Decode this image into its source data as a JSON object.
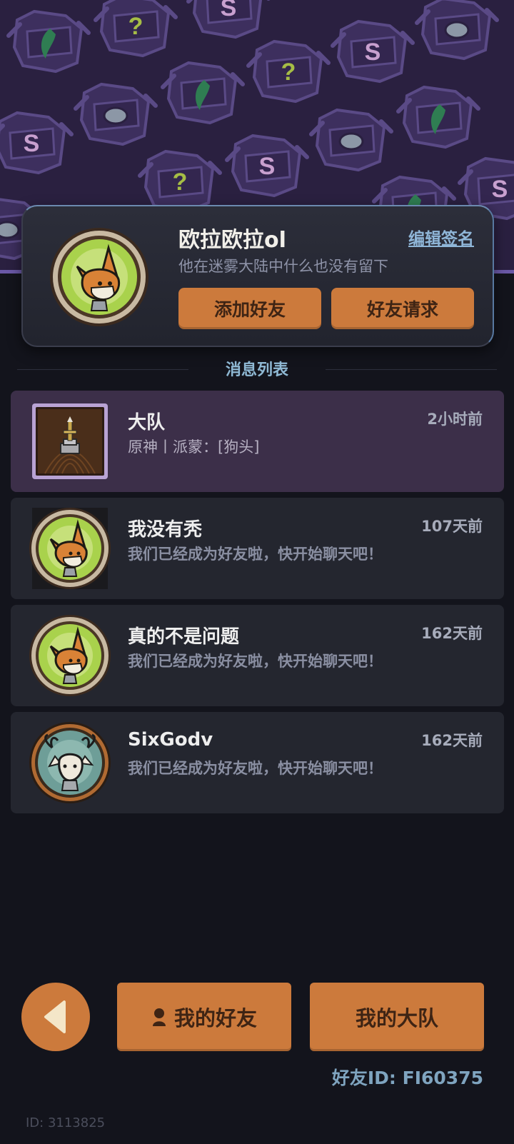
{
  "profile": {
    "name": "欧拉欧拉ol",
    "signature": "他在迷雾大陆中什么也没有留下",
    "edit_sign_label": "编辑签名",
    "add_friend_label": "添加好友",
    "friend_request_label": "好友请求"
  },
  "section_title": "消息列表",
  "messages": [
    {
      "title": "大队",
      "text": "原神丨派蒙：[狗头]",
      "time": "2小时前",
      "avatar": "team-sword-icon"
    },
    {
      "title": "我没有秃",
      "text": "我们已经成为好友啦，快开始聊天吧！",
      "time": "107天前",
      "avatar": "fox-avatar-icon"
    },
    {
      "title": "真的不是问题",
      "text": "我们已经成为好友啦，快开始聊天吧！",
      "time": "162天前",
      "avatar": "fox-avatar-icon"
    },
    {
      "title": "SixGodv",
      "text": "我们已经成为好友啦，快开始聊天吧！",
      "time": "162天前",
      "avatar": "antler-cat-avatar-icon"
    }
  ],
  "nav": {
    "my_friends_label": "我的好友",
    "my_team_label": "我的大队"
  },
  "friend_id": "好友ID: FI60375",
  "user_id": "ID: 3113825",
  "colors": {
    "accent": "#cc7a3c",
    "background": "#13141c",
    "card": "#24262f",
    "active_card": "#3c2f49",
    "link": "#8fb6d8"
  }
}
